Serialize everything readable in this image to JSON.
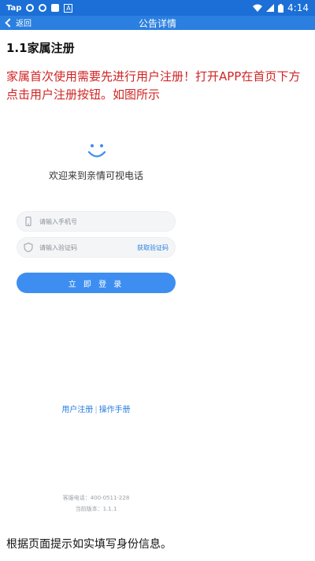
{
  "status_bar": {
    "app_label": "Tap",
    "time": "4:14",
    "icons": [
      "wifi-icon",
      "signal-icon",
      "battery-icon"
    ],
    "color": "#1b6fd6"
  },
  "nav": {
    "back_label": "返回",
    "title": "公告详情",
    "color": "#2a7fe0"
  },
  "article": {
    "heading": "1.1家属注册",
    "intro": "家属首次使用需要先进行用户注册！打开APP在首页下方点击用户注册按钮。如图所示",
    "intro_color": "#d02424",
    "closing": "根据页面提示如实填写身份信息。"
  },
  "screenshot": {
    "welcome": "欢迎来到亲情可视电话",
    "phone_placeholder": "请输入手机号",
    "code_placeholder": "请输入验证码",
    "get_code": "获取验证码",
    "login_button": "立 即 登 录",
    "register_link": "用户注册",
    "separator": "|",
    "manual_link": "操作手册",
    "hotline": "客服电话：400-0511-228",
    "version": "当前版本：1.1.1",
    "accent": "#3d8ef0"
  }
}
